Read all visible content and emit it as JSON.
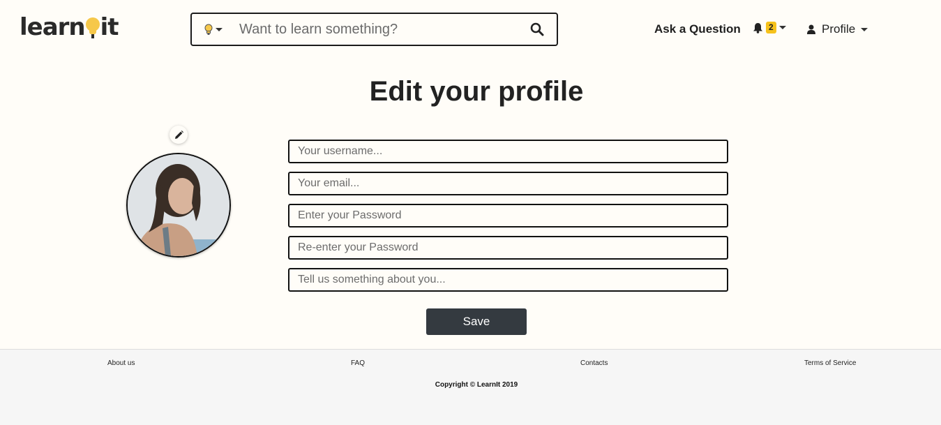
{
  "header": {
    "logo_text_left": "learn",
    "logo_text_right": "it",
    "search": {
      "placeholder": "Want to learn something?",
      "value": ""
    },
    "ask_label": "Ask a Question",
    "notifications_count": "2",
    "profile_label": "Profile"
  },
  "page": {
    "title": "Edit your profile"
  },
  "form": {
    "username_placeholder": "Your username...",
    "email_placeholder": "Your email...",
    "password_placeholder": "Enter your Password",
    "password_confirm_placeholder": "Re-enter your Password",
    "about_placeholder": "Tell us something about you...",
    "save_label": "Save"
  },
  "footer": {
    "links": [
      "About us",
      "FAQ",
      "Contacts",
      "Terms of Service"
    ],
    "copyright": "Copyright © LearnIt 2019"
  },
  "colors": {
    "accent_yellow": "#f6c84a",
    "badge_yellow": "#f6c21c",
    "button_dark": "#343a40",
    "page_bg": "#fffdf8",
    "footer_bg": "#f6f6f6"
  },
  "icons": [
    "lightbulb-icon",
    "search-icon",
    "bell-icon",
    "user-icon",
    "pencil-icon",
    "chevron-down-icon"
  ]
}
